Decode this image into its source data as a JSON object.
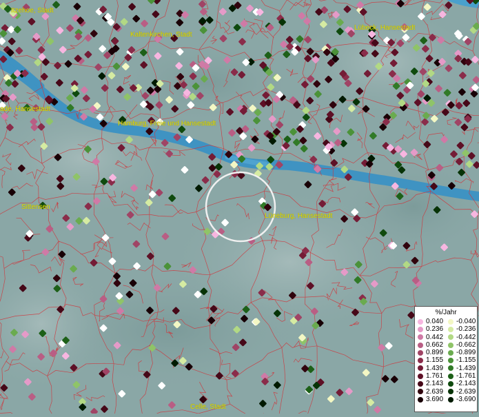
{
  "places": [
    {
      "name": "Itzehoe, Stadt",
      "key": "itzehoe"
    },
    {
      "name": "Kaltenkirchen, Stadt",
      "key": "kaltenkirchen"
    },
    {
      "name": "Lübeck, Hansestadt",
      "key": "luebeck"
    },
    {
      "name": "ade, Hansestadt",
      "key": "stade"
    },
    {
      "name": "Hamburg, Freie und Hansestadt",
      "key": "hamburg"
    },
    {
      "name": "Sittensen",
      "key": "sittensen"
    },
    {
      "name": "Lüneburg, Hansestadt",
      "key": "lueneburg"
    },
    {
      "name": "Celle, Stadt",
      "key": "celle"
    }
  ],
  "legend": {
    "title": "%/Jahr",
    "positive": [
      {
        "label": "0.040",
        "color": "#f7b6e0"
      },
      {
        "label": "0.236",
        "color": "#e59ac8"
      },
      {
        "label": "0.442",
        "color": "#cf7aa6"
      },
      {
        "label": "0.662",
        "color": "#b95e84"
      },
      {
        "label": "0.899",
        "color": "#a04465"
      },
      {
        "label": "1.155",
        "color": "#8a2c4a"
      },
      {
        "label": "1.439",
        "color": "#741c36"
      },
      {
        "label": "1.761",
        "color": "#5e1026"
      },
      {
        "label": "2.143",
        "color": "#460818"
      },
      {
        "label": "2.639",
        "color": "#30030d"
      },
      {
        "label": "3.690",
        "color": "#180006"
      }
    ],
    "negative": [
      {
        "label": "-0.040",
        "color": "#f3f7c4"
      },
      {
        "label": "-0.236",
        "color": "#d5eba2"
      },
      {
        "label": "-0.442",
        "color": "#b2d984"
      },
      {
        "label": "-0.662",
        "color": "#8fc468"
      },
      {
        "label": "-0.899",
        "color": "#6aab4f"
      },
      {
        "label": "-1.155",
        "color": "#4b9239"
      },
      {
        "label": "-1.439",
        "color": "#317a27"
      },
      {
        "label": "-1.761",
        "color": "#1d6018"
      },
      {
        "label": "-2.143",
        "color": "#0f4a0e"
      },
      {
        "label": "-2.639",
        "color": "#073306"
      },
      {
        "label": "-3.690",
        "color": "#011a01"
      }
    ]
  },
  "colors": {
    "land": "#8aa7a6",
    "water": "#3f93c2",
    "boundary": "#d0343a",
    "label": "#e6e000",
    "circle": "#f0f0f0"
  }
}
